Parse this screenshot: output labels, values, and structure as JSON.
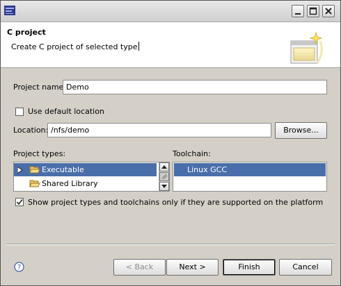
{
  "window": {
    "controls": {
      "minimize_icon": "minimize-icon",
      "maximize_icon": "maximize-icon",
      "close_icon": "close-icon"
    }
  },
  "header": {
    "title": "C project",
    "description": "Create C project of selected type"
  },
  "form": {
    "project_name_label": "Project name:",
    "project_name_value": "Demo",
    "use_default_location_label": "Use default location",
    "use_default_location_checked": false,
    "location_label": "Location:",
    "location_value": "/nfs/demo",
    "browse_button": "Browse..."
  },
  "project_types": {
    "label": "Project types:",
    "items": [
      {
        "label": "Executable",
        "selected": true,
        "expandable": true
      },
      {
        "label": "Shared Library",
        "selected": false,
        "expandable": false
      }
    ]
  },
  "toolchain": {
    "label": "Toolchain:",
    "items": [
      {
        "label": "Linux GCC",
        "selected": true
      }
    ]
  },
  "filter": {
    "label": "Show project types and toolchains only if they are supported on the platform",
    "checked": true
  },
  "buttons": {
    "back": "< Back",
    "next": "Next >",
    "finish": "Finish",
    "cancel": "Cancel"
  },
  "colors": {
    "selection": "#4a6ea9",
    "dialog_bg": "#d4d0c8",
    "header_bg": "#ffffff"
  }
}
